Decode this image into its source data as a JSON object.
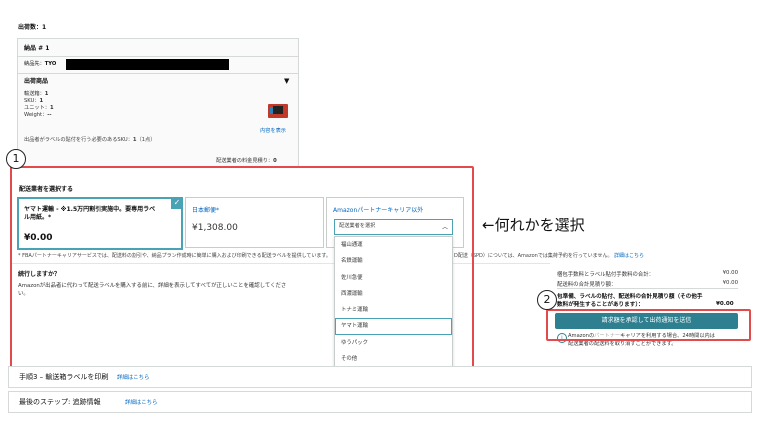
{
  "shipment": {
    "count_label": "出荷数：",
    "count_value": "1",
    "package_title": "納品 # 1",
    "dest_label": "納品先：",
    "dest_value": "TYO",
    "products_title": "出荷商品",
    "boxes_label": "輸送箱：",
    "boxes_value": "1",
    "sku_label": "SKU：",
    "sku_value": "1",
    "units_label": "ユニット：",
    "units_value": "1",
    "weight_label": "Weight：",
    "weight_value": "--",
    "show_contents": "内容を表示",
    "label_note": "出品者がラベルの貼付を行う必要のあるSKU：",
    "label_note_value": "1",
    "label_note_count": "（1点）",
    "fee_label": "配送業者の料金見積り：",
    "fee_value": "0"
  },
  "carrier_select": {
    "title": "配送業者を選択する",
    "options": [
      {
        "name": "ヤマト運輸 - ※1.5万円割引実施中。要専用ラベル用紙。*",
        "price": "¥0.00"
      },
      {
        "name": "日本郵便*",
        "price": "¥1,308.00"
      },
      {
        "name": "Amazonパートナーキャリア以外",
        "price": ""
      }
    ],
    "dropdown_placeholder": "配送業者を選択",
    "dropdown_items": [
      "福山通運",
      "名鉄運輸",
      "佐川急便",
      "西濃運輸",
      "トナミ運輸",
      "ヤマト運輸",
      "ゆうパック",
      "その他"
    ],
    "footnote_left": "* FBAパートナーキャリアサービスでは、配送料の割引や、納品プラン作成時に簡単に購入および印刷できる配送ラベルを提供しています。",
    "footnote_right": "D配送（SPD）については、Amazonでは集荷予約を行っていません。",
    "footnote_link": "詳細はこちら"
  },
  "continue": {
    "title": "続行しますか？",
    "body": "Amazonが出品者に代わって配送ラベルを購入する前に、詳細を表示してすべてが正しいことを確認してください。"
  },
  "summary": {
    "fee1_label": "梱包手数料とラベル貼付手数料の合計：",
    "fee1_value": "¥0.00",
    "fee2_label": "配送料の合計見積り額：",
    "fee2_value": "¥0.00",
    "total_label": "包準備、ラベルの貼付、配送料の合計見積り額（その他手数料が発生することがあります）：",
    "total_value": "¥0.00",
    "approve_button": "請求額を承認して出荷通知を送信",
    "note_left": "Amazonの",
    "note_right": "キャリアを利用する場合、24時間以内は",
    "note_line2": "配送業者の配送料を取り消すことができます。"
  },
  "annotations": {
    "marker1": "1",
    "marker2": "2",
    "arrow_text": "←何れかを選択"
  },
  "steps": {
    "step3_label": "手順3 – 輸送箱ラベルを印刷",
    "step3_link": "詳細はこちら",
    "final_label": "最後のステップ: 追跡情報",
    "final_link": "詳細はこちら"
  },
  "colors": {
    "annotation_red": "#e24b4b",
    "accent_teal": "#4aa3b5",
    "button_teal": "#2e7f8f",
    "link_blue": "#0066c0"
  }
}
